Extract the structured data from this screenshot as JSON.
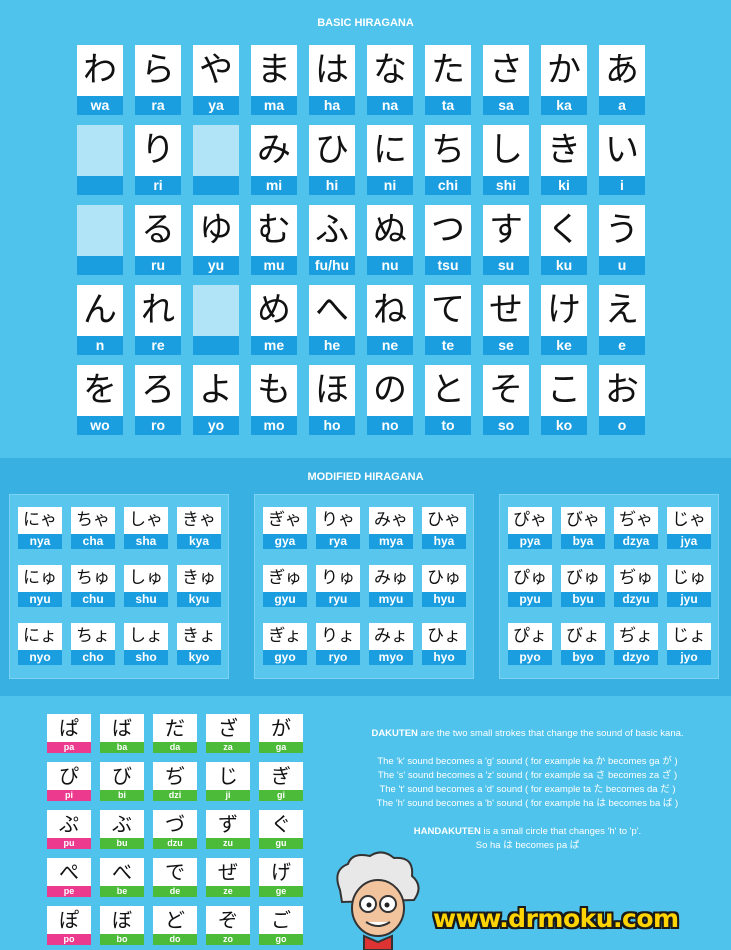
{
  "basic": {
    "title": "BASIC HIRAGANA",
    "rows": [
      [
        [
          "わ",
          "wa"
        ],
        [
          "ら",
          "ra"
        ],
        [
          "や",
          "ya"
        ],
        [
          "ま",
          "ma"
        ],
        [
          "は",
          "ha"
        ],
        [
          "な",
          "na"
        ],
        [
          "た",
          "ta"
        ],
        [
          "さ",
          "sa"
        ],
        [
          "か",
          "ka"
        ],
        [
          "あ",
          "a"
        ]
      ],
      [
        [
          "",
          ""
        ],
        [
          "り",
          "ri"
        ],
        [
          "",
          ""
        ],
        [
          "み",
          "mi"
        ],
        [
          "ひ",
          "hi"
        ],
        [
          "に",
          "ni"
        ],
        [
          "ち",
          "chi"
        ],
        [
          "し",
          "shi"
        ],
        [
          "き",
          "ki"
        ],
        [
          "い",
          "i"
        ]
      ],
      [
        [
          "",
          ""
        ],
        [
          "る",
          "ru"
        ],
        [
          "ゆ",
          "yu"
        ],
        [
          "む",
          "mu"
        ],
        [
          "ふ",
          "fu/hu"
        ],
        [
          "ぬ",
          "nu"
        ],
        [
          "つ",
          "tsu"
        ],
        [
          "す",
          "su"
        ],
        [
          "く",
          "ku"
        ],
        [
          "う",
          "u"
        ]
      ],
      [
        [
          "ん",
          "n"
        ],
        [
          "れ",
          "re"
        ],
        [
          "",
          ""
        ],
        [
          "め",
          "me"
        ],
        [
          "へ",
          "he"
        ],
        [
          "ね",
          "ne"
        ],
        [
          "て",
          "te"
        ],
        [
          "せ",
          "se"
        ],
        [
          "け",
          "ke"
        ],
        [
          "え",
          "e"
        ]
      ],
      [
        [
          "を",
          "wo"
        ],
        [
          "ろ",
          "ro"
        ],
        [
          "よ",
          "yo"
        ],
        [
          "も",
          "mo"
        ],
        [
          "ほ",
          "ho"
        ],
        [
          "の",
          "no"
        ],
        [
          "と",
          "to"
        ],
        [
          "そ",
          "so"
        ],
        [
          "こ",
          "ko"
        ],
        [
          "お",
          "o"
        ]
      ]
    ]
  },
  "modified": {
    "title": "MODIFIED HIRAGANA",
    "boxes": [
      [
        [
          [
            "にゃ",
            "nya"
          ],
          [
            "ちゃ",
            "cha"
          ],
          [
            "しゃ",
            "sha"
          ],
          [
            "きゃ",
            "kya"
          ]
        ],
        [
          [
            "にゅ",
            "nyu"
          ],
          [
            "ちゅ",
            "chu"
          ],
          [
            "しゅ",
            "shu"
          ],
          [
            "きゅ",
            "kyu"
          ]
        ],
        [
          [
            "にょ",
            "nyo"
          ],
          [
            "ちょ",
            "cho"
          ],
          [
            "しょ",
            "sho"
          ],
          [
            "きょ",
            "kyo"
          ]
        ]
      ],
      [
        [
          [
            "ぎゃ",
            "gya"
          ],
          [
            "りゃ",
            "rya"
          ],
          [
            "みゃ",
            "mya"
          ],
          [
            "ひゃ",
            "hya"
          ]
        ],
        [
          [
            "ぎゅ",
            "gyu"
          ],
          [
            "りゅ",
            "ryu"
          ],
          [
            "みゅ",
            "myu"
          ],
          [
            "ひゅ",
            "hyu"
          ]
        ],
        [
          [
            "ぎょ",
            "gyo"
          ],
          [
            "りょ",
            "ryo"
          ],
          [
            "みょ",
            "myo"
          ],
          [
            "ひょ",
            "hyo"
          ]
        ]
      ],
      [
        [
          [
            "ぴゃ",
            "pya"
          ],
          [
            "びゃ",
            "bya"
          ],
          [
            "ぢゃ",
            "dzya"
          ],
          [
            "じゃ",
            "jya"
          ]
        ],
        [
          [
            "ぴゅ",
            "pyu"
          ],
          [
            "びゅ",
            "byu"
          ],
          [
            "ぢゅ",
            "dzyu"
          ],
          [
            "じゅ",
            "jyu"
          ]
        ],
        [
          [
            "ぴょ",
            "pyo"
          ],
          [
            "びょ",
            "byo"
          ],
          [
            "ぢょ",
            "dzyo"
          ],
          [
            "じょ",
            "jyo"
          ]
        ]
      ]
    ]
  },
  "dakuten": {
    "rows": [
      [
        [
          "ぱ",
          "pa",
          "pink"
        ],
        [
          "ば",
          "ba",
          "green"
        ],
        [
          "だ",
          "da",
          "green"
        ],
        [
          "ざ",
          "za",
          "green"
        ],
        [
          "が",
          "ga",
          "green"
        ]
      ],
      [
        [
          "ぴ",
          "pi",
          "pink"
        ],
        [
          "び",
          "bi",
          "green"
        ],
        [
          "ぢ",
          "dzi",
          "green"
        ],
        [
          "じ",
          "ji",
          "green"
        ],
        [
          "ぎ",
          "gi",
          "green"
        ]
      ],
      [
        [
          "ぷ",
          "pu",
          "pink"
        ],
        [
          "ぶ",
          "bu",
          "green"
        ],
        [
          "づ",
          "dzu",
          "green"
        ],
        [
          "ず",
          "zu",
          "green"
        ],
        [
          "ぐ",
          "gu",
          "green"
        ]
      ],
      [
        [
          "ぺ",
          "pe",
          "pink"
        ],
        [
          "べ",
          "be",
          "green"
        ],
        [
          "で",
          "de",
          "green"
        ],
        [
          "ぜ",
          "ze",
          "green"
        ],
        [
          "げ",
          "ge",
          "green"
        ]
      ],
      [
        [
          "ぽ",
          "po",
          "pink"
        ],
        [
          "ぼ",
          "bo",
          "green"
        ],
        [
          "ど",
          "do",
          "green"
        ],
        [
          "ぞ",
          "zo",
          "green"
        ],
        [
          "ご",
          "go",
          "green"
        ]
      ]
    ]
  },
  "explanation": {
    "dakuten_term": "DAKUTEN",
    "dakuten_desc": " are the two small strokes that change the sound of basic kana.",
    "lines": [
      "The 'k' sound becomes a 'g' sound ( for example ka か becomes ga が )",
      "The 's' sound becomes a 'z' sound ( for example sa さ becomes za ざ )",
      "The 't' sound becomes a 'd' sound ( for example ta た becomes da だ )",
      "The 'h' sound becomes a 'b' sound ( for example ha は becomes ba ば )"
    ],
    "handakuten_term": "HANDAKUTEN",
    "handakuten_desc": " is a small circle that changes 'h' to 'p'.",
    "handakuten_example": "So ha は becomes pa ぱ"
  },
  "logo": {
    "text": "www.drmoku.com",
    "mascot_icon": "professor-mascot-icon"
  },
  "colors": {
    "background": "#4fc3ec",
    "romaji_band": "#1a9ee0",
    "pink": "#ec3b8f",
    "green": "#4cbb3a",
    "logo_yellow": "#ffd400"
  }
}
